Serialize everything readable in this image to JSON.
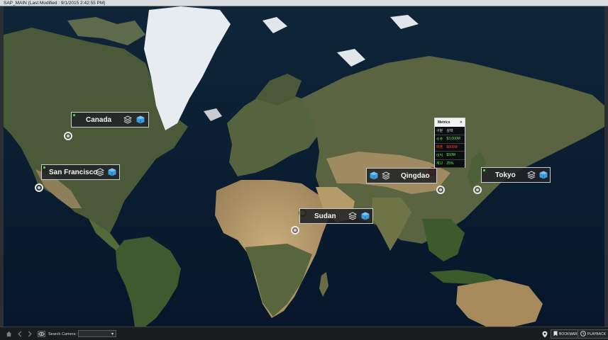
{
  "window": {
    "title": "SAP_MAIN (Last Modified : 9/1/2015 2:42:55 PM)"
  },
  "locations": [
    {
      "name": "Canada",
      "status_color": "#3ee23e"
    },
    {
      "name": "San Francisco",
      "status_color": "#3ee23e"
    },
    {
      "name": "Qingdao",
      "status_color": "#e33030"
    },
    {
      "name": "Sudan",
      "status_color": "#e8d317"
    },
    {
      "name": "Tokyo",
      "status_color": "#3ee23e"
    }
  ],
  "metrics": {
    "title": "Metrics",
    "close_glyph": "✕",
    "header": [
      "구분",
      "상태"
    ],
    "rows": [
      {
        "label": "수주",
        "value": "$3,000M",
        "color": "#5df25d"
      },
      {
        "label": "매출",
        "value": "$800M",
        "color": "#ff3b3b"
      },
      {
        "label": "이익",
        "value": "$50M",
        "color": "#5df25d"
      },
      {
        "label": "재고",
        "value": "25%",
        "color": "#5df25d"
      }
    ]
  },
  "toolbar": {
    "search_label": "Search Camera :",
    "search_value": "",
    "bookmark_label": "BOOKMARK",
    "playback_label": "PLAYBACK",
    "icons": [
      "home-icon",
      "back-arrow-icon",
      "forward-arrow-icon",
      "eye-icon",
      "location-pin-icon",
      "bookmark-icon",
      "playback-icon"
    ]
  },
  "colors": {
    "ocean": "#0b1f33",
    "land_green": "#4d5b3a",
    "land_desert": "#b59c71",
    "ice": "#e6ecf0",
    "cube_blue": "#3a9be2"
  }
}
